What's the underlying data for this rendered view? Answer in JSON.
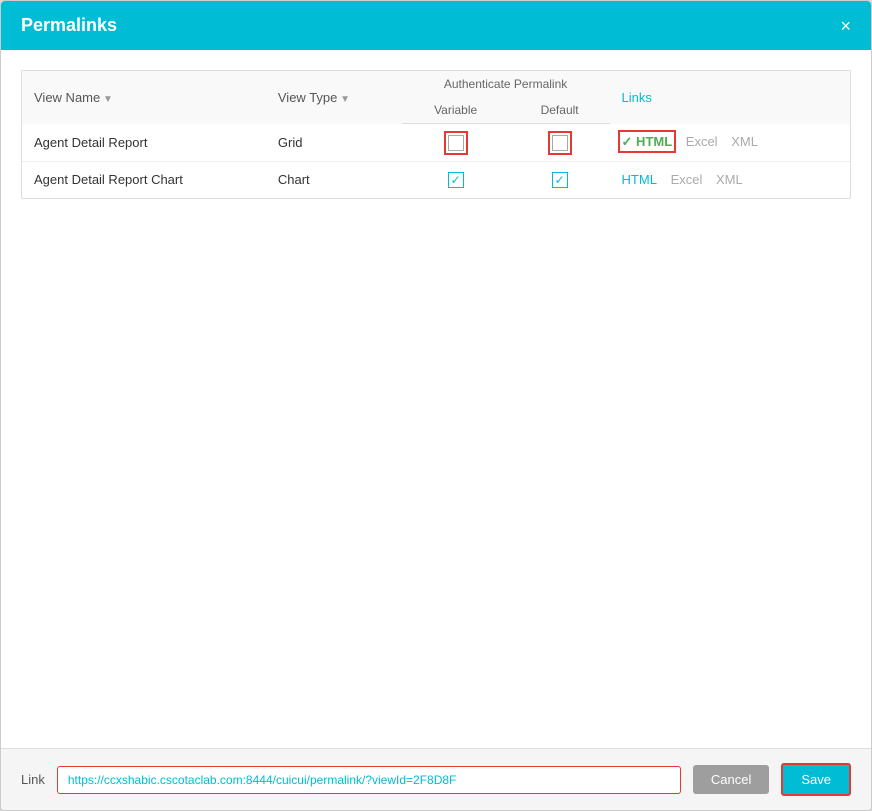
{
  "dialog": {
    "title": "Permalinks",
    "close_label": "×"
  },
  "table": {
    "headers": {
      "view_name": "View Name",
      "view_type": "View Type",
      "authenticate_group": "Authenticate Permalink",
      "variable": "Variable",
      "default": "Default",
      "links": "Links"
    },
    "rows": [
      {
        "view_name": "Agent Detail Report",
        "view_type": "Grid",
        "variable_checked": false,
        "default_checked": false,
        "html_active": true,
        "html_label": "HTML",
        "excel_label": "Excel",
        "xml_label": "XML"
      },
      {
        "view_name": "Agent Detail Report Chart",
        "view_type": "Chart",
        "variable_checked": true,
        "default_checked": true,
        "html_active": false,
        "html_label": "HTML",
        "excel_label": "Excel",
        "xml_label": "XML"
      }
    ]
  },
  "footer": {
    "link_label": "Link",
    "url": "https://ccxshabic.cscotaclab.com:8444/cuicui/permalink/?viewId=2F8D8F",
    "cancel_label": "Cancel",
    "save_label": "Save"
  }
}
